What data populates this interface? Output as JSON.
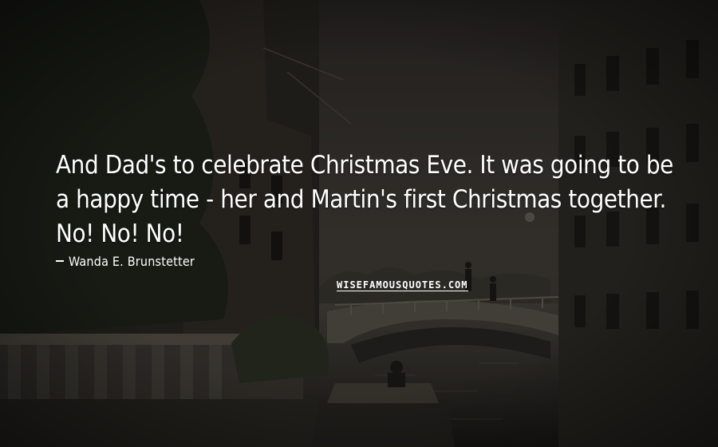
{
  "quote": {
    "text": "And Dad's to celebrate Christmas Eve. It was going to be a happy time - her and Martin's first Christmas together. No! No! No!"
  },
  "author": {
    "dash": "-",
    "name": "Wanda E. Brunstetter"
  },
  "watermark": {
    "text": "WISEFAMOUSQUOTES.COM"
  },
  "background": {
    "description_colors": {
      "sky": "#3a3530",
      "water": "#2b2925",
      "buildings": "#24211d"
    }
  }
}
